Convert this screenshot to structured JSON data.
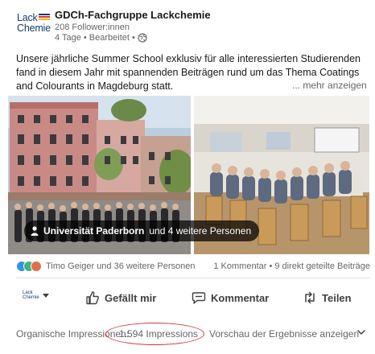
{
  "post": {
    "org_name": "GDCh-Fachgruppe Lackchemie",
    "followers": "208 Follower:innen",
    "meta": "4 Tage • Bearbeitet •",
    "logo_line1": "Lack",
    "logo_line2": "Chemie",
    "text": "Unsere jährliche Summer School exklusiv für alle interessierten Studierenden fand in diesem Jahr mit spannenden Beiträgen rund um das Thema Coatings and Colourants in Magdeburg statt.",
    "more_label": "... mehr anzeigen"
  },
  "images": {
    "tag_bold": "Universität Paderborn",
    "tag_rest": "und 4 weitere Personen"
  },
  "social": {
    "reactors": "Timo Geiger und 36 weitere Personen",
    "engagement": "1 Kommentar • 9 direkt geteilte Beiträge"
  },
  "actions": {
    "switcher_line1": "Lack",
    "switcher_line2": "Chemie",
    "like": "Gefällt mir",
    "comment": "Kommentar",
    "share": "Teilen"
  },
  "impressions": {
    "label": "Organische Impressionen:",
    "count": "1.594 Impressions",
    "preview": "Vorschau der Ergebnisse anzeigen"
  },
  "colors": {
    "brand_navy": "#1a3b6e",
    "reaction_like": "#378fe9",
    "reaction_celebrate": "#44b37f",
    "reaction_love": "#df704d",
    "annotation_red": "#d33a3a"
  },
  "icons": {
    "globe": "globe-icon",
    "person": "person-icon",
    "like": "thumbs-up-icon",
    "comment": "comment-icon",
    "share": "repost-icon",
    "chevron": "chevron-down-icon"
  }
}
